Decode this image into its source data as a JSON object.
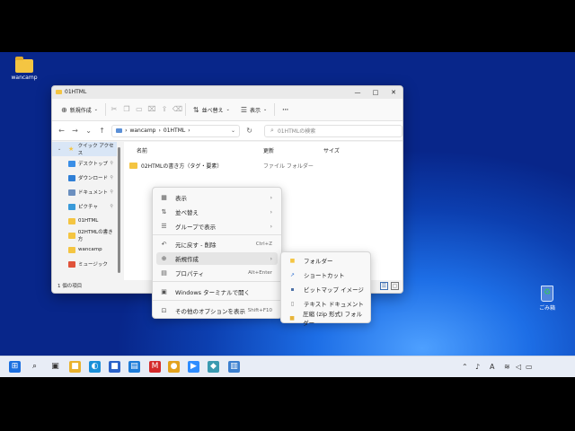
{
  "desktop": {
    "icons": [
      {
        "label": "wancamp"
      },
      {
        "label": "ごみ箱"
      }
    ]
  },
  "explorer": {
    "tab_title": "01HTML",
    "cmd": {
      "new_label": "新規作成",
      "sort_label": "並べ替え",
      "view_label": "表示",
      "more_label": "···"
    },
    "address": {
      "segments": [
        "wancamp",
        "01HTML"
      ],
      "sep": "›"
    },
    "search_placeholder": "01HTMLの検索",
    "nav_items": [
      {
        "label": "クイック アクセス",
        "icon": "star-icon",
        "color": "#f4c542"
      },
      {
        "label": "デスクトップ",
        "icon": "desktop-icon",
        "color": "#3a8ee6"
      },
      {
        "label": "ダウンロード",
        "icon": "download-icon",
        "color": "#2f7fd6"
      },
      {
        "label": "ドキュメント",
        "icon": "document-icon",
        "color": "#6b8fbf"
      },
      {
        "label": "ピクチャ",
        "icon": "picture-icon",
        "color": "#3a9ad9"
      },
      {
        "label": "01HTML",
        "icon": "folder-icon",
        "color": "#f4c542"
      },
      {
        "label": "02HTMLの書き方",
        "icon": "folder-icon",
        "color": "#f4c542"
      },
      {
        "label": "wancamp",
        "icon": "folder-icon",
        "color": "#f4c542"
      },
      {
        "label": "ミュージック",
        "icon": "music-icon",
        "color": "#e0533a"
      }
    ],
    "columns": {
      "name": "名前",
      "date": "更新",
      "type": "種類",
      "size": "サイズ"
    },
    "files": [
      {
        "name": "02HTMLの書き方（タグ・要素）",
        "type": "ファイル フォルダー"
      }
    ],
    "status": "1 個の項目"
  },
  "context_menu": {
    "items": [
      {
        "label": "表示",
        "icon": "view-icon",
        "glyph": "▦",
        "arrow": true
      },
      {
        "label": "並べ替え",
        "icon": "sort-icon",
        "glyph": "⇅",
        "arrow": true
      },
      {
        "label": "グループで表示",
        "icon": "group-icon",
        "glyph": "☰",
        "arrow": true
      },
      {
        "label": "元に戻す - 削除",
        "icon": "undo-icon",
        "glyph": "↶",
        "shortcut": "Ctrl+Z"
      },
      {
        "label": "新規作成",
        "icon": "new-icon",
        "glyph": "⊕",
        "arrow": true
      },
      {
        "label": "プロパティ",
        "icon": "properties-icon",
        "glyph": "▤",
        "shortcut": "Alt+Enter"
      },
      {
        "label": "Windows ターミナルで開く",
        "icon": "terminal-icon",
        "glyph": "▣"
      },
      {
        "label": "その他のオプションを表示",
        "icon": "more-options-icon",
        "glyph": "⊡",
        "shortcut": "Shift+F10"
      }
    ]
  },
  "submenu": {
    "items": [
      {
        "label": "フォルダー",
        "icon": "folder-icon",
        "glyph": "■",
        "color": "#f4c542"
      },
      {
        "label": "ショートカット",
        "icon": "shortcut-icon",
        "glyph": "↗",
        "color": "#2f6fd1"
      },
      {
        "label": "ビットマップ イメージ",
        "icon": "bitmap-icon",
        "glyph": "▪",
        "color": "#4a6fa5"
      },
      {
        "label": "テキスト ドキュメント",
        "icon": "text-doc-icon",
        "glyph": "▯",
        "color": "#777777"
      },
      {
        "label": "圧縮 (zip 形式) フォルダー",
        "icon": "zip-icon",
        "glyph": "■",
        "color": "#e7b43a"
      }
    ]
  },
  "taskbar": {
    "apps": [
      {
        "name": "start-icon",
        "glyph": "⊞",
        "color": "#1b6fe0"
      },
      {
        "name": "search-icon",
        "glyph": "⌕",
        "color": "#1a1a1a"
      },
      {
        "name": "task-view-icon",
        "glyph": "▣",
        "color": "#333333"
      },
      {
        "name": "file-explorer-icon",
        "glyph": "■",
        "color": "#e9b22d"
      },
      {
        "name": "edge-icon",
        "glyph": "◐",
        "color": "#1a8fd8"
      },
      {
        "name": "store-icon",
        "glyph": "■",
        "color": "#2a62c9"
      },
      {
        "name": "app-icon-1",
        "glyph": "▤",
        "color": "#1c7bd8"
      },
      {
        "name": "mcafee-icon",
        "glyph": "M",
        "color": "#d42a2a"
      },
      {
        "name": "chrome-icon",
        "glyph": "●",
        "color": "#e2a21d"
      },
      {
        "name": "zoom-icon",
        "glyph": "▶",
        "color": "#2d8cff"
      },
      {
        "name": "app-icon-2",
        "glyph": "◆",
        "color": "#3a9ab0"
      },
      {
        "name": "notepad-icon",
        "glyph": "▥",
        "color": "#3b7fcf"
      }
    ],
    "tray": [
      {
        "name": "chevron-up-icon",
        "glyph": "⌃"
      },
      {
        "name": "mic-icon",
        "glyph": "♪"
      },
      {
        "name": "font-icon",
        "glyph": "A"
      },
      {
        "name": "wifi-icon",
        "glyph": "≋"
      },
      {
        "name": "volume-icon",
        "glyph": "◁"
      },
      {
        "name": "battery-icon",
        "glyph": "▭"
      }
    ]
  }
}
